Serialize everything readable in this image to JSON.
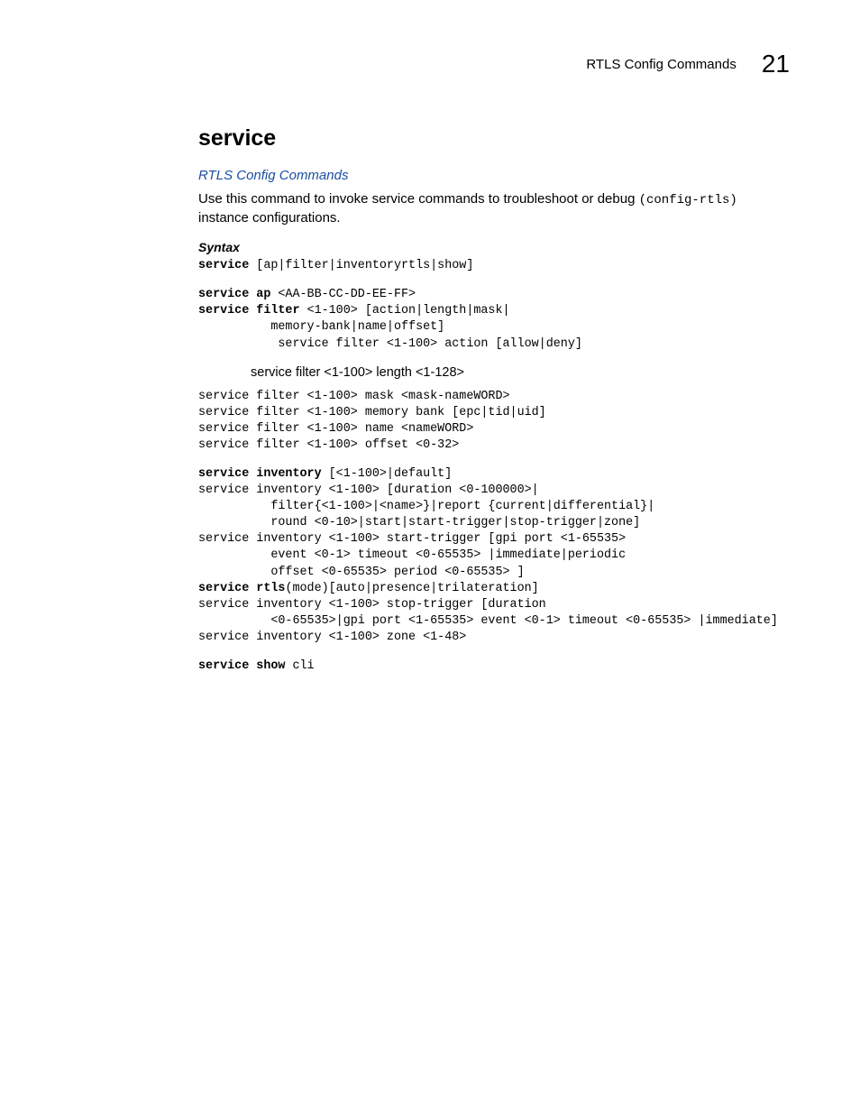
{
  "header": {
    "section": "RTLS Config Commands",
    "pagenum": "21"
  },
  "title": "service",
  "link": "RTLS Config Commands",
  "intro_prefix": "Use this command to invoke service commands to troubleshoot or debug ",
  "intro_mono": "(config-rtls)",
  "intro_suffix": " instance configurations.",
  "syntax_head": "Syntax",
  "code1_b": "service",
  "code1_r": " [ap|filter|inventoryrtls|show]",
  "code2_b": "service ap",
  "code2_r": " <AA-BB-CC-DD-EE-FF>",
  "code3_b": "service filter",
  "code3_r": " <1-100> [action|length|mask|\n          memory-bank|name|offset]\n           service filter <1-100> action [allow|deny]",
  "plain_line": "service filter <1-100> length <1-128>",
  "code4": "service filter <1-100> mask <mask-nameWORD>\nservice filter <1-100> memory bank [epc|tid|uid]\nservice filter <1-100> name <nameWORD>\nservice filter <1-100> offset <0-32>",
  "code5_b": "service inventory",
  "code5_r": " [<1-100>|default]\nservice inventory <1-100> [duration <0-100000>|\n          filter{<1-100>|<name>}|report {current|differential}|\n          round <0-10>|start|start-trigger|stop-trigger|zone]\nservice inventory <1-100> start-trigger [gpi port <1-65535>\n          event <0-1> timeout <0-65535> |immediate|periodic\n          offset <0-65535> period <0-65535> ]",
  "code6_b": "service rtls",
  "code6_r": "(mode)[auto|presence|trilateration]\nservice inventory <1-100> stop-trigger [duration\n          <0-65535>|gpi port <1-65535> event <0-1> timeout <0-65535> |immediate]\nservice inventory <1-100> zone <1-48>",
  "code7_b": "service show",
  "code7_r": " cli"
}
